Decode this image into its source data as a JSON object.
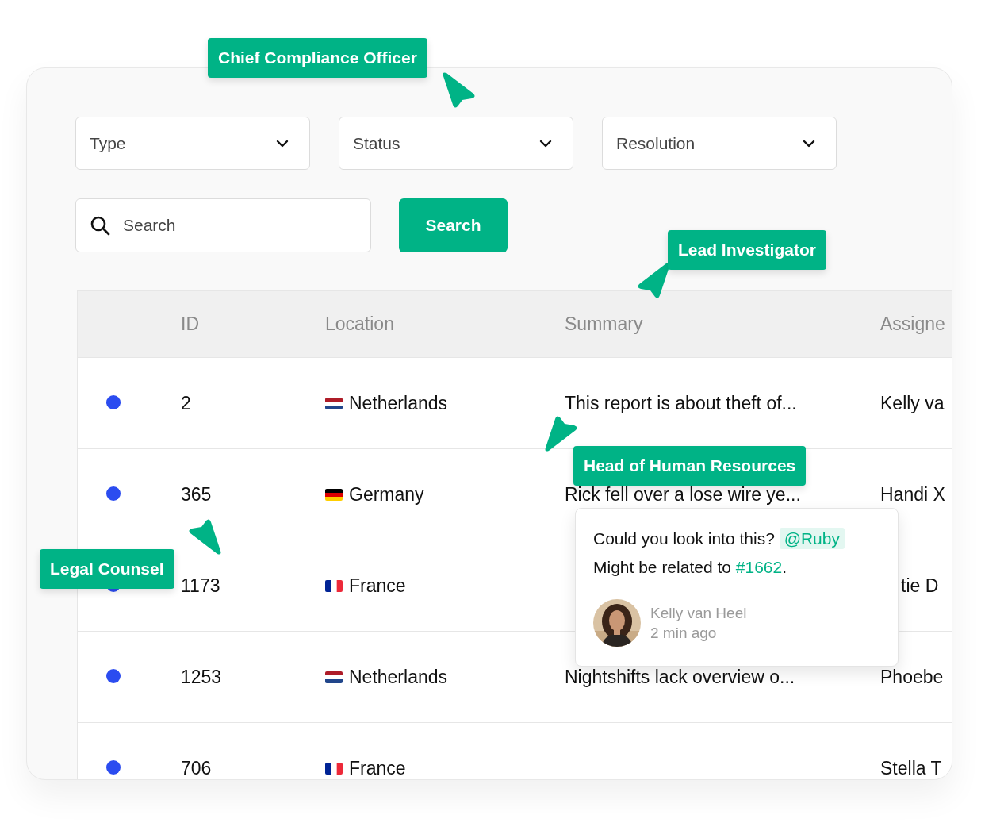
{
  "filters": [
    {
      "label": "Type"
    },
    {
      "label": "Status"
    },
    {
      "label": "Resolution"
    }
  ],
  "search": {
    "placeholder": "Search",
    "button": "Search"
  },
  "table": {
    "columns": [
      "ID",
      "Location",
      "Summary",
      "Assigne"
    ],
    "rows": [
      {
        "id": "2",
        "location": {
          "kind": "nl",
          "text": "Netherlands"
        },
        "summary": "This report is about theft of...",
        "assignee": "Kelly va",
        "covered": false
      },
      {
        "id": "365",
        "location": {
          "kind": "de",
          "text": "Germany"
        },
        "summary": "Rick fell over a lose wire ye...",
        "assignee": "Handi X",
        "covered": false
      },
      {
        "id": "1173",
        "location": {
          "kind": "fr",
          "text": "France"
        },
        "assignee": "tie D",
        "covered": true
      },
      {
        "id": "1253",
        "location": {
          "kind": "nl",
          "text": "Netherlands"
        },
        "summary": "Nightshifts lack overview o...",
        "assignee": "Phoebe",
        "covered": false
      },
      {
        "id": "706",
        "location": {
          "kind": "fr",
          "text": "France"
        },
        "assignee": "Stella T",
        "covered": false
      }
    ]
  },
  "comment": {
    "text": "Could you look into this?",
    "mention": "@Ruby",
    "text2": "Might be related to",
    "link": "#1662",
    "text2_end": ".",
    "author": "Kelly van Heel",
    "time": "2 min ago"
  },
  "cursors": [
    {
      "label": "Chief Compliance Officer",
      "kind": "downright"
    },
    {
      "label": "Lead Investigator",
      "kind": "downleft"
    },
    {
      "label": "Head of Human Resources",
      "kind": "upleft"
    },
    {
      "label": "Legal Counsel",
      "kind": "upright"
    }
  ]
}
